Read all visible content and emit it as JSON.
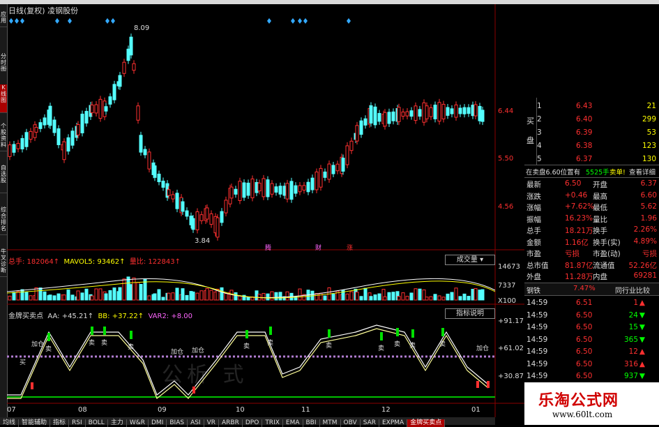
{
  "chart_title": "日线(复权) 凌钢股份",
  "left_tabs": [
    "应用",
    "分时图",
    "K线图",
    "个股资料",
    "自选股",
    "综合排名",
    "牛叉诊断"
  ],
  "price_axis": [
    "6.44",
    "5.50",
    "4.56"
  ],
  "price_marks": {
    "high": "8.09",
    "low": "3.84"
  },
  "event_labels": [
    "腾",
    "财",
    "涨"
  ],
  "volume": {
    "label_total": "总手: 182064↑",
    "label_mavol": "MAVOL5: 93462↑",
    "label_ratio": "量比: 122843↑",
    "dropdown": "成交量",
    "axis": [
      "14673",
      "7337",
      "X100"
    ]
  },
  "indicator": {
    "label_name": "金牌买卖点",
    "label_aa": "AA: +45.21↑",
    "label_bb": "BB: +37.22↑",
    "label_var2": "VAR2: +8.00",
    "button": "指标说明",
    "axis": [
      "+91.17",
      "+61.02",
      "+30.87"
    ],
    "signals": [
      "加仓",
      "卖",
      "买"
    ]
  },
  "date_axis": [
    "07",
    "08",
    "09",
    "10",
    "11",
    "12",
    "01"
  ],
  "order_book": {
    "side_label": "买盘",
    "rows": [
      {
        "n": "1",
        "price": "6.43",
        "vol": "21"
      },
      {
        "n": "2",
        "price": "6.40",
        "vol": "299"
      },
      {
        "n": "3",
        "price": "6.39",
        "vol": "53"
      },
      {
        "n": "4",
        "price": "6.38",
        "vol": "123"
      },
      {
        "n": "5",
        "price": "6.37",
        "vol": "130"
      }
    ]
  },
  "sell_note": {
    "text": "在卖盘6.60位置有",
    "vol": "5525手",
    "buy_btn": "卖单!",
    "detail_btn": "查看详细"
  },
  "quote": [
    {
      "k1": "最新",
      "v1": "6.50",
      "k2": "开盘",
      "v2": "6.37"
    },
    {
      "k1": "涨跌",
      "v1": "+0.46",
      "k2": "最高",
      "v2": "6.60"
    },
    {
      "k1": "涨幅",
      "v1": "+7.62%",
      "k2": "最低",
      "v2": "5.62"
    },
    {
      "k1": "振幅",
      "v1": "16.23%",
      "k2": "量比",
      "v2": "1.96"
    },
    {
      "k1": "总手",
      "v1": "18.21万",
      "k2": "换手",
      "v2": "2.26%"
    },
    {
      "k1": "金额",
      "v1": "1.16亿",
      "k2": "换手(实)",
      "v2": "4.89%"
    },
    {
      "k1": "市盈",
      "v1": "亏损",
      "k2": "市盈(动)",
      "v2": "亏损"
    },
    {
      "k1": "总市值",
      "v1": "81.87亿",
      "k2": "流通值",
      "v2": "52.26亿"
    },
    {
      "k1": "外盘",
      "v1": "11.28万",
      "k2": "内盘",
      "v2": "69281"
    }
  ],
  "industry": {
    "name": "钢铁",
    "pct": "7.47%",
    "btn": "同行业比较"
  },
  "ticks": [
    {
      "t": "14:59",
      "p": "6.51",
      "v": "1",
      "dir": "up"
    },
    {
      "t": "14:59",
      "p": "6.50",
      "v": "24",
      "dir": "down"
    },
    {
      "t": "14:59",
      "p": "6.50",
      "v": "15",
      "dir": "down"
    },
    {
      "t": "14:59",
      "p": "6.50",
      "v": "365",
      "dir": "down"
    },
    {
      "t": "14:59",
      "p": "6.50",
      "v": "12",
      "dir": "up"
    },
    {
      "t": "14:59",
      "p": "6.50",
      "v": "316",
      "dir": "up"
    },
    {
      "t": "14:59",
      "p": "6.50",
      "v": "937",
      "dir": "down"
    }
  ],
  "bottom_tabs": [
    "均线",
    "智能辅助",
    "指标",
    "RSI",
    "BOLL",
    "主力",
    "W&R",
    "DMI",
    "BIAS",
    "ASI",
    "VR",
    "ARBR",
    "DPO",
    "TRIX",
    "EMA",
    "BBI",
    "MTM",
    "OBV",
    "SAR",
    "EXPMA",
    "金牌买卖点"
  ],
  "brand": {
    "title": "乐淘公式网",
    "url": "www.60lt.com"
  },
  "watermark": "公析  式"
}
